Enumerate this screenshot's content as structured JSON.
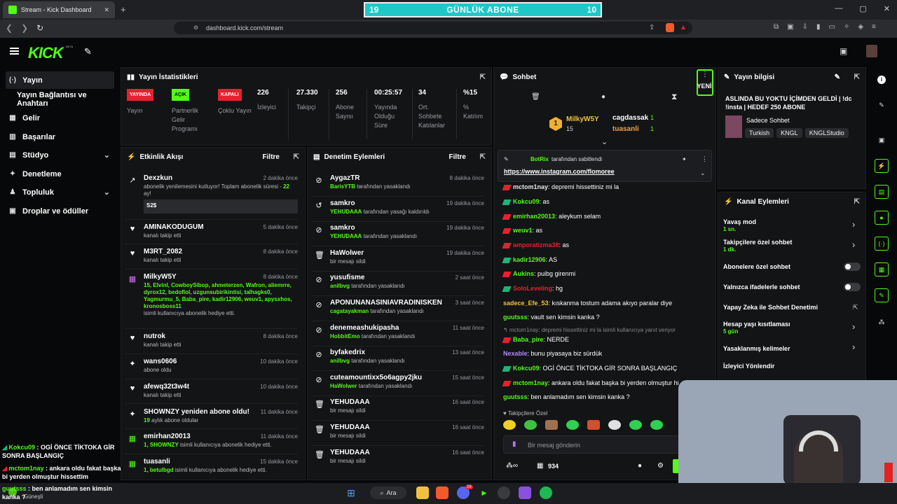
{
  "browser": {
    "tab_title": "Stream - Kick Dashboard",
    "new_tab": "+",
    "url": "dashboard.kick.com/stream",
    "win_min": "—",
    "win_max": "▢",
    "win_close": "✕"
  },
  "overlay_top": {
    "left": "19",
    "label": "GÜNLÜK ABONE",
    "right": "10"
  },
  "app": {
    "logo": "KICK",
    "beta": "BETA"
  },
  "sidebar": {
    "items": [
      {
        "label": "Yayın",
        "icon": "broadcast-icon"
      },
      {
        "label": "Yayın Bağlantısı ve Anahtarı",
        "icon": ""
      },
      {
        "label": "Gelir",
        "icon": "dollar-icon"
      },
      {
        "label": "Başarılar",
        "icon": "trophy-icon"
      },
      {
        "label": "Stüdyo",
        "icon": "studio-icon"
      },
      {
        "label": "Denetleme",
        "icon": "shield-icon"
      },
      {
        "label": "Topluluk",
        "icon": "community-icon"
      },
      {
        "label": "Droplar ve ödüller",
        "icon": "gift-icon"
      }
    ]
  },
  "stats": {
    "title": "Yayın İstatistikleri",
    "items": [
      {
        "value": "YAYINDA",
        "label": "Yayın",
        "badge_color": "#e5202f"
      },
      {
        "value": "AÇIK",
        "label": "Partnerlik Gelir Programı",
        "badge_color": "#53fc18"
      },
      {
        "value": "KAPALI",
        "label": "Çoklu Yayın",
        "badge_color": "#e5202f"
      },
      {
        "value": "226",
        "label": "İzleyici"
      },
      {
        "value": "27.330",
        "label": "Takipçi"
      },
      {
        "value": "256",
        "label": "Abone Sayısı"
      },
      {
        "value": "00:25:57",
        "label": "Yayında Olduğu Süre"
      },
      {
        "value": "34",
        "label": "Ort. Sohbete Katılanlar"
      },
      {
        "value": "%15",
        "label": "% Katılım"
      }
    ]
  },
  "activity": {
    "title": "Etkinlik Akışı",
    "filter": "Filtre",
    "items": [
      {
        "name": "Dexzkun",
        "time": "2 dakika önce",
        "sub": "abonelik yenilemesini kutluyor! Toplam abonelik süresi - ",
        "sub_g": "22",
        "sub2": " ay!",
        "msg": "S2$"
      },
      {
        "name": "AMINAKODUGUM",
        "time": "5 dakika önce",
        "sub": "kanalı takip etti"
      },
      {
        "name": "M3RT_2082",
        "time": "8 dakika önce",
        "sub": "kanalı takip etti"
      },
      {
        "name": "MilkyW5Y",
        "time": "8 dakika önce",
        "sub_g": "15, Elvinl, CowboySibop, ahmeterzen, Wafron, aliemrre, dyrox12, bedoflol, uzgunsubirikintisi, talhagks0, Yagmurmu_5, Baba_pire, kadir12906, weuv1, apysxhos, kronosboss11",
        "sub": "isimli kullanıcıya abonelik hediye etti."
      },
      {
        "name": "nutrok",
        "time": "8 dakika önce",
        "sub": "kanalı takip etti"
      },
      {
        "name": "wans0606",
        "time": "10 dakika önce",
        "sub": "abone oldu"
      },
      {
        "name": "afewq32t3w4t",
        "time": "10 dakika önce",
        "sub": "kanalı takip etti"
      },
      {
        "name": "SHOWNZY yeniden abone oldu!",
        "time": "11 dakika önce",
        "sub_g": "19",
        "sub": " aylık abone oldular"
      },
      {
        "name": "emirhan20013",
        "time": "11 dakika önce",
        "sub_g": "1, SHOWNZY",
        "sub": " isimli kullanıcıya abonelik hediye etti."
      },
      {
        "name": "tuasanli",
        "time": "15 dakika önce",
        "sub_g": "1, betulbgd",
        "sub": " isimli kullanıcıya abonelik hediye etti."
      }
    ]
  },
  "moderation": {
    "title": "Denetim Eylemleri",
    "filter": "Filtre",
    "items": [
      {
        "name": "AygazTR",
        "time": "8 dakika önce",
        "by": "BarisYTB",
        "sub": " tarafından yasaklandı"
      },
      {
        "name": "samkro",
        "time": "19 dakika önce",
        "by": "YEHUDAAA",
        "sub": " tarafından yasağı kaldırıldı"
      },
      {
        "name": "samkro",
        "time": "19 dakika önce",
        "by": "YEHUDAAA",
        "sub": " tarafından yasaklandı"
      },
      {
        "name": "HaWolwer",
        "time": "19 dakika önce",
        "by": "",
        "sub": "bir mesajı sildi"
      },
      {
        "name": "yusufisme",
        "time": "2 saat önce",
        "by": "anilbvg",
        "sub": " tarafından yasaklandı"
      },
      {
        "name": "APONUNANASINIAVRADINISKEN",
        "time": "3 saat önce",
        "by": "cagatayakman",
        "sub": " tarafından yasaklandı"
      },
      {
        "name": "denemeashukipasha",
        "time": "11 saat önce",
        "by": "HobbitEmo",
        "sub": " tarafından yasaklandı"
      },
      {
        "name": "byfakedrix",
        "time": "13 saat önce",
        "by": "anilbvg",
        "sub": " tarafından yasaklandı"
      },
      {
        "name": "cuteamountixx5o6agpy2jku",
        "time": "15 saat önce",
        "by": "HaWolwer",
        "sub": " tarafından yasaklandı"
      },
      {
        "name": "YEHUDAAA",
        "time": "16 saat önce",
        "by": "",
        "sub": "bir mesajı sildi"
      },
      {
        "name": "YEHUDAAA",
        "time": "16 saat önce",
        "by": "",
        "sub": "bir mesajı sildi"
      },
      {
        "name": "YEHUDAAA",
        "time": "16 saat önce",
        "by": "",
        "sub": "bir mesajı sildi"
      }
    ]
  },
  "chat": {
    "title": "Sohbet",
    "new": "YENİ",
    "leader": {
      "first": "MilkyW5Y",
      "first_count": "15",
      "second": "cagdassak",
      "second_count": "1",
      "third": "tuasanli",
      "third_count": "1"
    },
    "pinned": {
      "by": "BotRix",
      "by_text": "tarafından sabitlendi",
      "link": "https://www.instagram.com/flomoree"
    },
    "messages": [
      {
        "user": "mctom1nay",
        "text": "depremi hissettiniz mi la",
        "color": "#e8e8e8",
        "icon": "#e5202f"
      },
      {
        "user": "Kokcu09",
        "text": "as",
        "color": "#53fc18",
        "icon": "#1fb37a"
      },
      {
        "user": "emirhan20013",
        "text": "aleykum selam",
        "color": "#53fc18",
        "icon": "#e5202f"
      },
      {
        "user": "weuv1",
        "text": "as",
        "color": "#53fc18",
        "icon": "#e5202f"
      },
      {
        "user": "amporatizma38",
        "text": "as",
        "color": "#e5202f",
        "icon": "#e5202f"
      },
      {
        "user": "kadir12906",
        "text": "AS",
        "color": "#53fc18",
        "icon": "#1fb37a"
      },
      {
        "user": "Aukins",
        "text": "puibg girenmi",
        "color": "#53fc18",
        "icon": "#e5202f"
      },
      {
        "user": "SoloLeveling",
        "text": "hg",
        "color": "#e5202f",
        "icon": "#1fb37a"
      },
      {
        "user": "sadece_Efe_53",
        "text": "kıskanma tostum adama akıyo paralar diye",
        "color": "#f0c040",
        "icon": ""
      },
      {
        "user": "guutsss",
        "text": "vault sen kimsin kanka ?",
        "color": "#53fc18",
        "icon": ""
      },
      {
        "user": "",
        "text": "mctom1nay: depremi hissettiniz mi la isimli kullanıcıya yanıt veriyor",
        "color": "#888",
        "icon": "reply"
      },
      {
        "user": "Baba_pire",
        "text": "NERDE",
        "color": "#53fc18",
        "icon": "#e5202f"
      },
      {
        "user": "Nexable",
        "text": "bunu piyasaya biz sürdük",
        "color": "#b088ff",
        "icon": ""
      },
      {
        "user": "Kokcu09",
        "text": "OGİ ÖNCE TİKTOKA GİR SONRA BAŞLANGIÇ",
        "color": "#53fc18",
        "icon": "#1fb37a"
      },
      {
        "user": "mctom1nay",
        "text": "ankara oldu fakat başka bi yerden olmuştur hi",
        "color": "#53fc18",
        "icon": "#e5202f"
      },
      {
        "user": "guutsss",
        "text": "ben anlamadım sen kimsin kanka ?",
        "color": "#53fc18",
        "icon": ""
      }
    ],
    "followers_only": "Takipçilere Özel",
    "placeholder": "Bir mesaj gönderin",
    "points": "934"
  },
  "info": {
    "title": "Yayın bilgisi",
    "stream_title": "ASLINDA BU YOKTU İÇİMDEN GELDİ | !dc !insta | HEDEF 250 ABONE",
    "category": "Sadece Sohbet",
    "tags": [
      "Turkish",
      "KNGL",
      "KNGLStudio"
    ]
  },
  "channel_actions": {
    "title": "Kanal Eylemleri",
    "items": [
      {
        "label": "Yavaş mod",
        "sub": "1 sn.",
        "kind": "chevron"
      },
      {
        "label": "Takipçilere özel sohbet",
        "sub": "1 dk.",
        "kind": "chevron"
      },
      {
        "label": "Abonelere özel sohbet",
        "sub": "",
        "kind": "toggle"
      },
      {
        "label": "Yalnızca ifadelerle sohbet",
        "sub": "",
        "kind": "toggle"
      },
      {
        "label": "Yapay Zeka ile Sohbet Denetimi",
        "sub": "",
        "kind": "link"
      },
      {
        "label": "Hesap yaşı kısıtlaması",
        "sub": "5 gün",
        "kind": "chevron"
      },
      {
        "label": "Yasaklanmış kelimeler",
        "sub": "",
        "kind": "chevron"
      },
      {
        "label": "İzleyici Yönlendir",
        "sub": "",
        "kind": "none"
      }
    ]
  },
  "stream_overlay": {
    "lines": [
      {
        "user": "Kokcu09",
        "text": " : OGİ ÖNCE TİKTOKA GİR SONRA BAŞLANGIÇ"
      },
      {
        "user": "mctom1nay",
        "text": " : ankara oldu fakat başka bi yerden olmuştur hissettim"
      },
      {
        "user": "guutsss",
        "text": " : ben anlamadım sen kimsin kanka ?"
      }
    ]
  },
  "taskbar": {
    "search": "Ara",
    "weather": "Güneşli",
    "badge": "29"
  }
}
